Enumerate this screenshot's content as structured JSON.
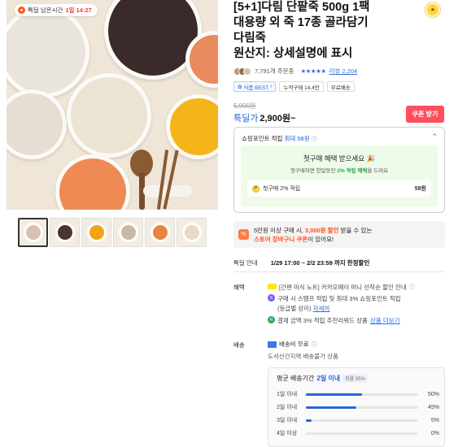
{
  "hero": {
    "timer_label": "특딜 남은시간",
    "timer_value": "1일 14:27",
    "thumbnail_count": 6
  },
  "product": {
    "title_lines": [
      "[5+1]다림 단팥죽 500g 1팩",
      "대용량 외 죽 17종 골라담기",
      "다림죽",
      "원산지: 상세설명에 표시"
    ],
    "order_count": "7,791개 주문중",
    "stars": "★★★★★",
    "review_text": "리뷰 2,204",
    "chips": [
      "식품 BEST",
      "누적구매 14.4만",
      "무료배송"
    ]
  },
  "price": {
    "original": "5,900원",
    "label": "특딜가",
    "sale": "2,900원~",
    "coupon_button": "쿠폰 받기"
  },
  "points": {
    "header_prefix": "쇼핑포인트 적립",
    "header_value": "최대 58원",
    "first_title": "첫구매 혜택 받으세요",
    "first_sub_prefix": "첫구매하면 한달동안",
    "first_sub_highlight": "2% 적립 혜택",
    "first_sub_suffix": "을 드려요",
    "first_row_label": "첫구매 2% 적립",
    "first_row_amount": "58원"
  },
  "promo": {
    "line1_prefix": "5만원 이상 구매 시,",
    "line1_highlight": "3,000원 할인",
    "line1_suffix": "받을 수 있는",
    "line2_highlight": "스토어 장바구니 쿠폰",
    "line2_suffix": "이 있어요!"
  },
  "sale_info": {
    "label": "특딜 안내",
    "value": "1/29 17:00 ~ 2/2 23:59 까지 한정할인"
  },
  "benefits": {
    "label": "혜택",
    "item1": "[간편 미식 노트] 카카오페이 머니 선착순 할인 안내",
    "item2_line1": "구매 시 스탬프 적립 및 최대 3% 쇼핑포인트 적립",
    "item2_line2_prefix": "(등급별 상이)",
    "item2_link": "자세히",
    "item3_prefix": "결제 금액 3% 적립 추천리워드 상품",
    "item3_link": "상품 더보기"
  },
  "shipping": {
    "label": "배송",
    "fee": "배송비 무료",
    "note": "도서산간지역 배송불가 상품",
    "avg_prefix": "평균 배송기간",
    "avg_value": "2일 이내",
    "avg_pct": "확률 95%",
    "rows": [
      {
        "label": "1일 이내",
        "value": "50%",
        "ratio": 0.5
      },
      {
        "label": "2일 이내",
        "value": "45%",
        "ratio": 0.45
      },
      {
        "label": "3일 이내",
        "value": "5%",
        "ratio": 0.05
      },
      {
        "label": "4일 이상",
        "value": "0%",
        "ratio": 0.0
      }
    ]
  },
  "colors": {
    "accent_blue": "#1f62e0",
    "coupon_red": "#ff4e5e",
    "promo_orange": "#ff4e1f",
    "first_bg": "#eefbe9"
  }
}
